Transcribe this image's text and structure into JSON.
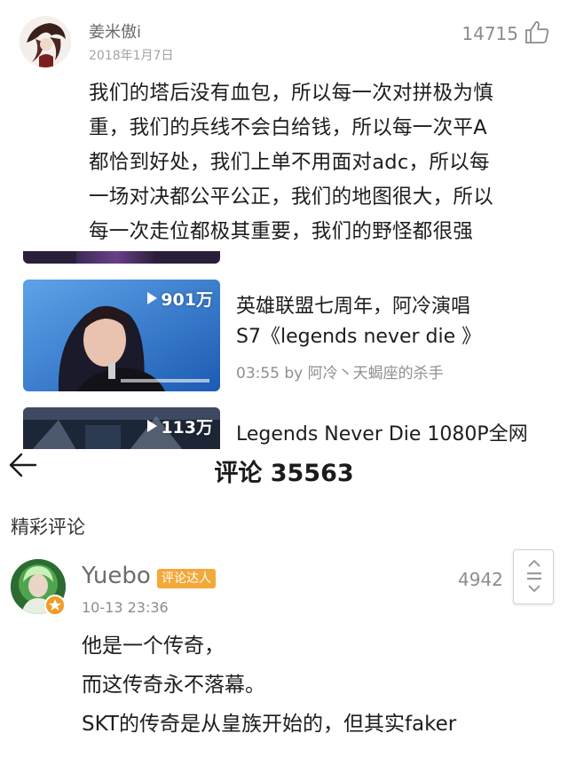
{
  "top_comment": {
    "username": "姜米傲i",
    "date": "2018年1月7日",
    "likes": "14715",
    "lines": [
      "我们的塔后没有血包，所以每一次对拼极为慎",
      "重，我们的兵线不会白给钱，所以每一次平A",
      "都恰到好处，我们上单不用面对adc，所以每",
      "一场对决都公平公正，我们的地图很大，所以",
      "每一次走位都极其重要，我们的野怪都很强"
    ]
  },
  "videos": [
    {
      "views": "901万",
      "title_line1": "英雄联盟七周年，阿冷演唱",
      "title_line2": "S7《legends never die 》",
      "meta": "03:55 by 阿冷丶天蝎座的杀手"
    },
    {
      "views": "113万",
      "title_line1": "Legends Never Die 1080P全网",
      "title_line2": "",
      "meta": ""
    }
  ],
  "comments_panel": {
    "title": "评论 35563",
    "section_label": "精彩评论",
    "comment": {
      "username": "Yuebo",
      "tag": "评论达人",
      "date": "10-13 23:36",
      "likes": "4942",
      "lines": [
        "他是一个传奇，",
        "而这传奇永不落幕。",
        "SKT的传奇是从皇族开始的，但其实faker"
      ]
    }
  },
  "icons": {
    "like": "thumbs-up-icon",
    "back": "back-arrow-icon",
    "play": "play-icon",
    "scroll": "scroll-handle-icon",
    "vip": "vip-badge-icon"
  }
}
